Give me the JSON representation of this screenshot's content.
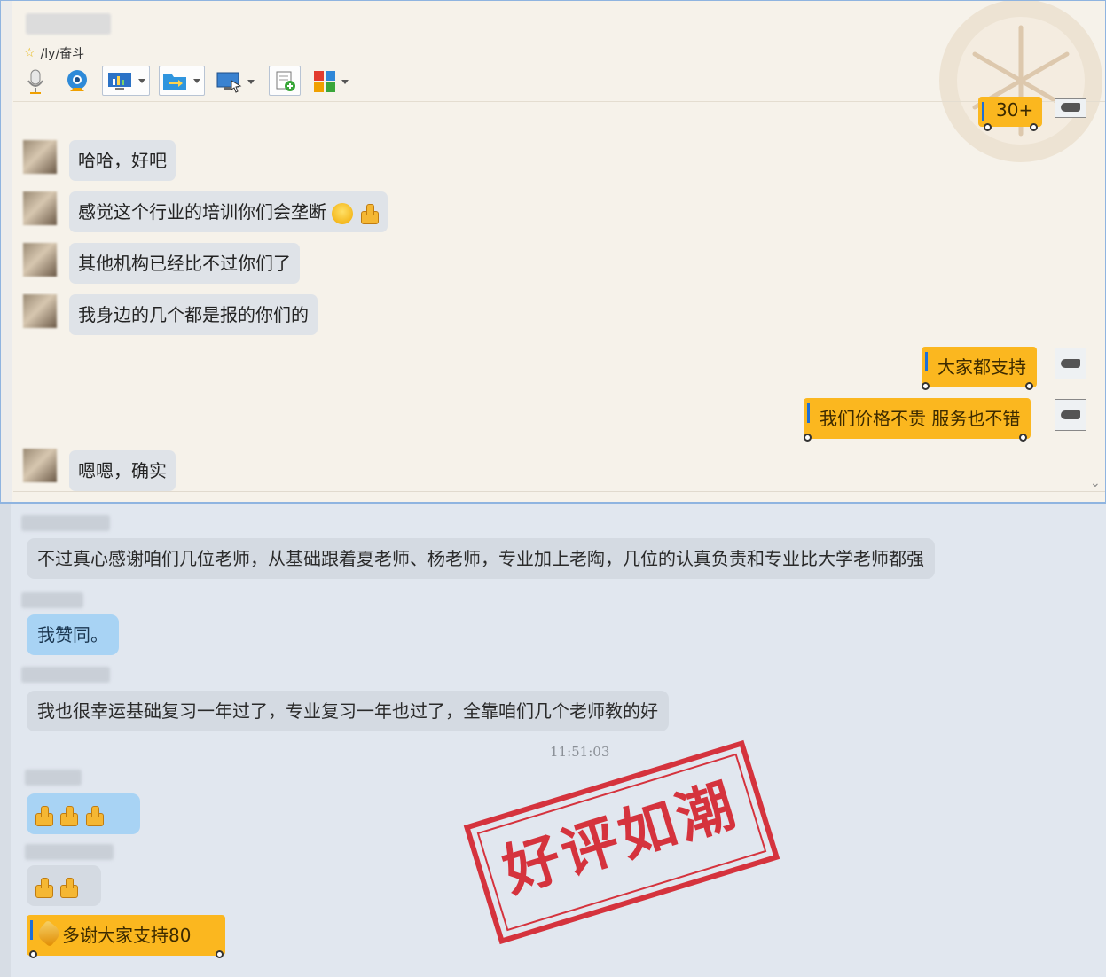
{
  "top_panel": {
    "contact_subtitle": "/ly/奋斗",
    "badge_count": "30+",
    "messages_left": [
      {
        "text": "哈哈，好吧"
      },
      {
        "text": "感觉这个行业的培训你们会垄断"
      },
      {
        "text": "其他机构已经比不过你们了"
      },
      {
        "text": "我身边的几个都是报的你们的"
      },
      {
        "text": "嗯嗯，确实"
      }
    ],
    "messages_right": [
      {
        "text": "大家都支持"
      },
      {
        "text": "我们价格不贵 服务也不错"
      }
    ],
    "toolbar_icons": [
      "microphone-icon",
      "camera-icon",
      "chart-icon",
      "folder-transfer-icon",
      "remote-desktop-icon",
      "file-send-icon",
      "apps-icon"
    ],
    "accent_color": "#fbb71f"
  },
  "bottom_panel": {
    "messages": [
      {
        "text": "不过真心感谢咱们几位老师，从基础跟着夏老师、杨老师，专业加上老陶，几位的认真负责和专业比大学老师都强"
      },
      {
        "text": "我赞同。"
      },
      {
        "text": "我也很幸运基础复习一年过了，专业复习一年也过了，全靠咱们几个老师教的好"
      },
      {
        "text": "多谢大家支持80"
      }
    ],
    "timestamp": "11:51:03",
    "stamp_text": "好评如潮"
  }
}
